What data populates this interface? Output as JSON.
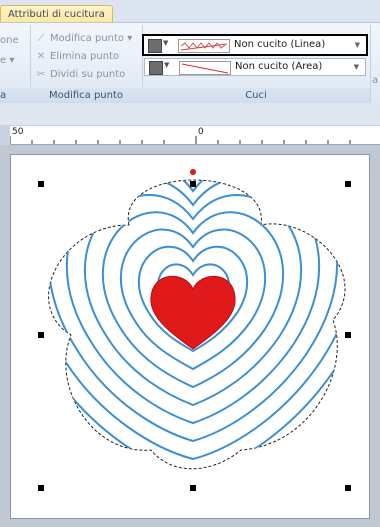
{
  "ribbon": {
    "active_tab": "Attributi di cucitura",
    "cut_group": {
      "item1": "one",
      "item2": "e"
    },
    "modify_group": {
      "label": "Modifica punto",
      "items": [
        "Modifica punto",
        "Elimina punto",
        "Dividi su punto"
      ]
    },
    "cuci_group": {
      "label": "Cuci",
      "line_sew": "Non cucito (Linea)",
      "area_sew": "Non cucito (Area)"
    },
    "right_stub": "a"
  },
  "ruler": {
    "label_left": "50",
    "label_mid": "0"
  },
  "colors": {
    "stitch_blue": "#3b8fd2",
    "heart_red": "#e01a1a",
    "handle": "#000000"
  },
  "icons": [
    "edit-point-icon",
    "delete-point-icon",
    "split-point-icon",
    "color-swatch-icon",
    "chevron-down-icon"
  ]
}
